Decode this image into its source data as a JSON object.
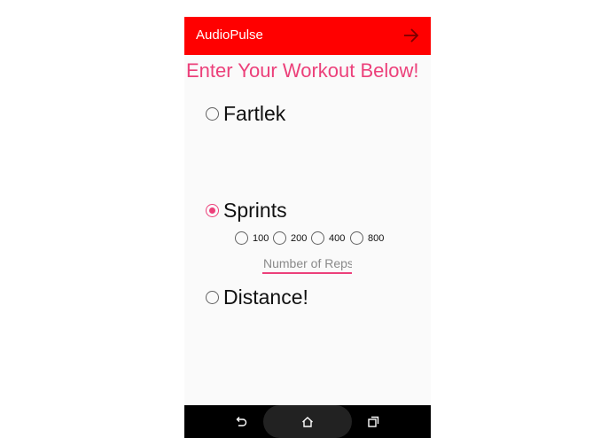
{
  "app": {
    "title": "AudioPulse"
  },
  "page": {
    "heading": "Enter Your Workout Below!"
  },
  "workout_types": [
    {
      "label": "Fartlek",
      "checked": false
    },
    {
      "label": "Sprints",
      "checked": true
    },
    {
      "label": "Distance!",
      "checked": false
    }
  ],
  "sprint_distances": [
    "100",
    "200",
    "400",
    "800"
  ],
  "reps_input": {
    "placeholder": "Number of Reps",
    "value": ""
  },
  "colors": {
    "appbar": "#ff0000",
    "accent": "#ec407a",
    "navbar": "#000000"
  },
  "icons": {
    "appbar_action": "arrow-right-icon",
    "nav_back": "back-icon",
    "nav_home": "home-icon",
    "nav_recents": "recents-icon"
  }
}
